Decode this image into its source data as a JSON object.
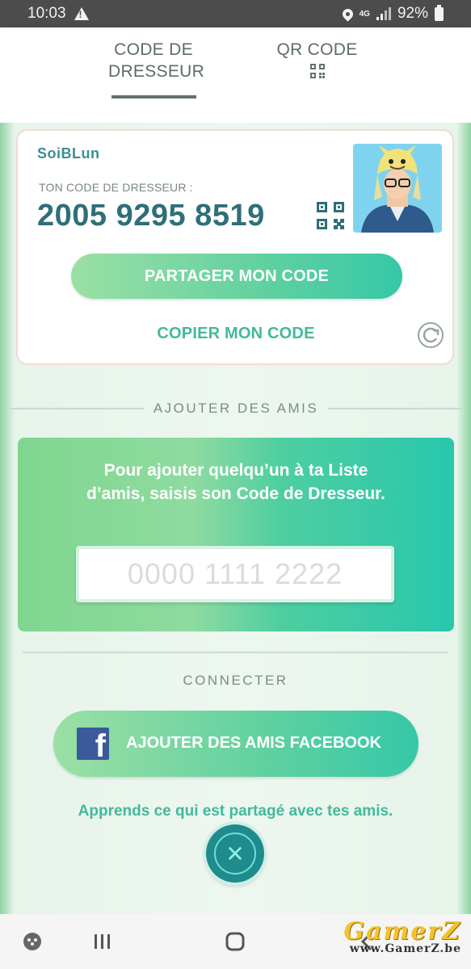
{
  "status_bar": {
    "time": "10:03",
    "network": "4G",
    "battery": "92%",
    "icons": [
      "warning-icon",
      "location-icon",
      "signal-icon",
      "battery-icon"
    ]
  },
  "tabs": [
    {
      "label": "CODE DE DRESSEUR",
      "active": true
    },
    {
      "label": "QR CODE",
      "icon": "qr-code-icon",
      "active": false
    }
  ],
  "trainer": {
    "name": "SoiBLun",
    "code_label": "TON CODE DE DRESSEUR :",
    "code": "2005 9295 8519"
  },
  "actions": {
    "share_label": "PARTAGER MON CODE",
    "copy_label": "COPIER MON CODE"
  },
  "add_friends": {
    "section_title": "AJOUTER DES AMIS",
    "instructions": "Pour ajouter quelqu’un à ta Liste d’amis, saisis son Code de Dresseur.",
    "input_value": "",
    "input_placeholder": "0000 1111 2222"
  },
  "connect": {
    "section_title": "CONNECTER",
    "facebook_label": "AJOUTER DES AMIS FACEBOOK",
    "learn_label": "Apprends ce qui est partagé avec tes amis."
  },
  "watermark": {
    "title": "GamerZ",
    "url": "www.GamerZ.be"
  },
  "colors": {
    "accent_teal": "#2e6f78",
    "accent_green": "#43b99a",
    "facebook_blue": "#3a5a99",
    "close_button": "#1e8c8c"
  }
}
